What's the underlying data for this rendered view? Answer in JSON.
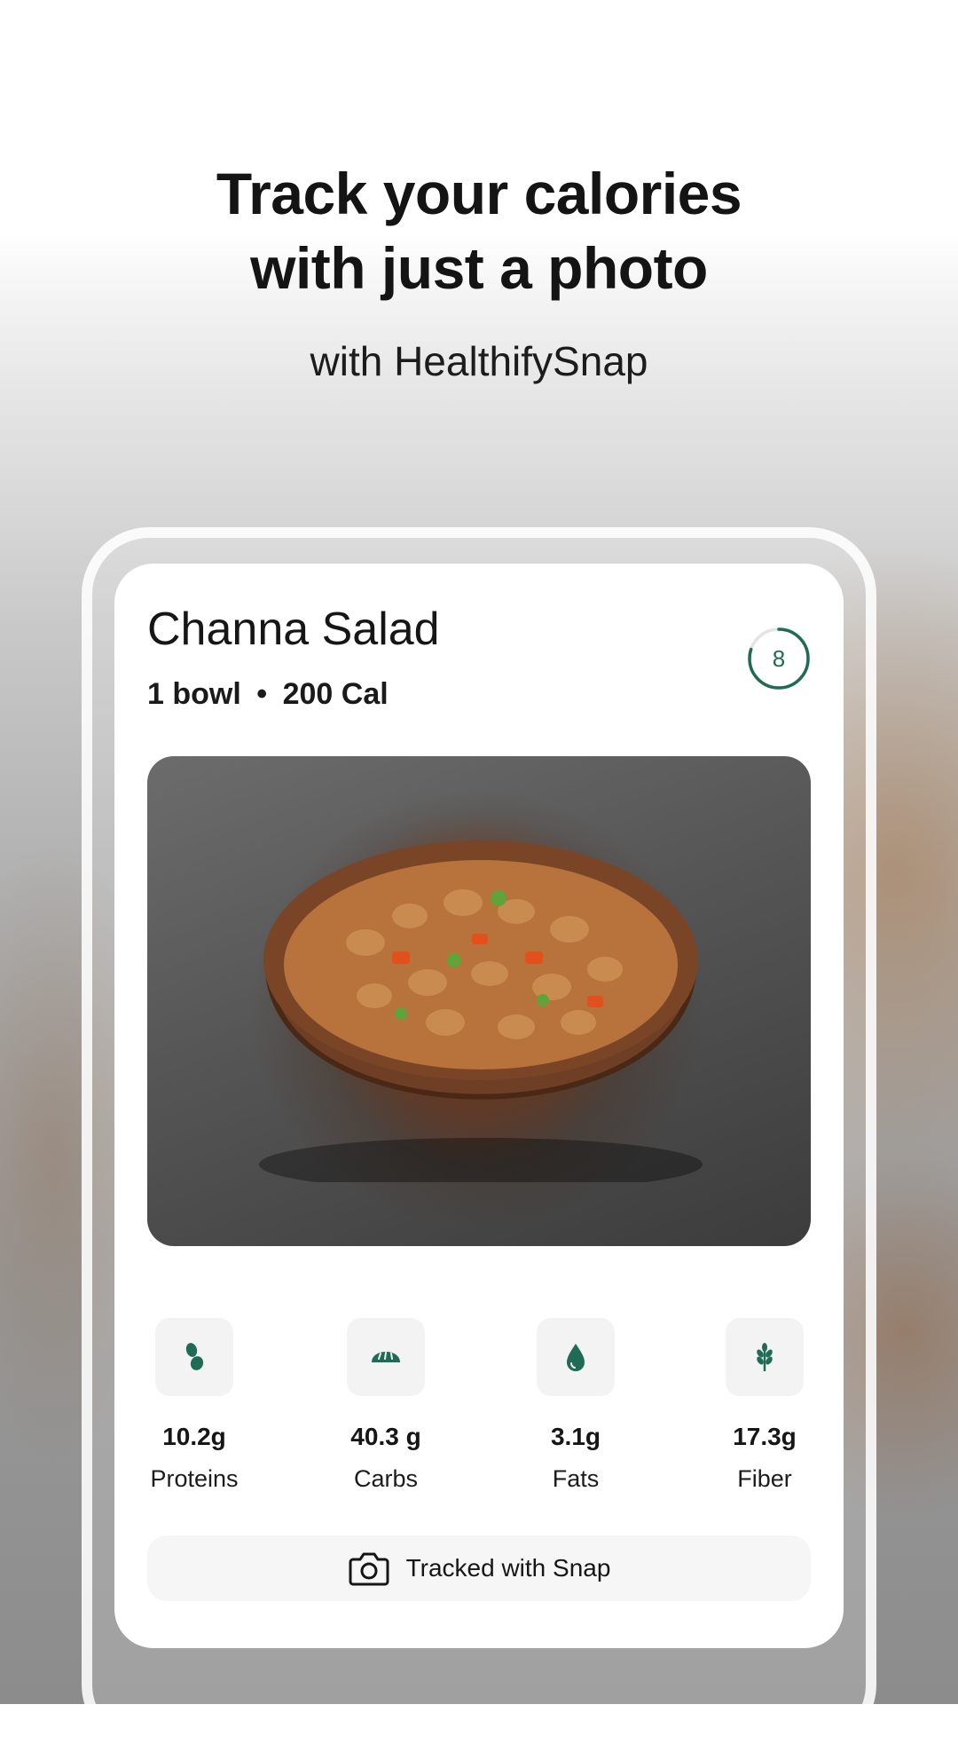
{
  "hero": {
    "title_line1": "Track your calories",
    "title_line2": "with just a photo",
    "subtitle": "with HealthifySnap"
  },
  "meal": {
    "name": "Channa Salad",
    "portion": "1 bowl",
    "separator": "•",
    "calories": "200 Cal",
    "score": "8",
    "score_fraction": 0.8
  },
  "macros": [
    {
      "icon": "bean-icon",
      "value": "10.2g",
      "label": "Proteins"
    },
    {
      "icon": "bread-icon",
      "value": "40.3 g",
      "label": "Carbs"
    },
    {
      "icon": "drop-icon",
      "value": "3.1g",
      "label": "Fats"
    },
    {
      "icon": "wheat-icon",
      "value": "17.3g",
      "label": "Fiber"
    }
  ],
  "snap_button": {
    "icon": "camera-icon",
    "label": "Tracked with Snap"
  },
  "colors": {
    "accent": "#1f6b56",
    "tile": "#f3f3f3"
  }
}
